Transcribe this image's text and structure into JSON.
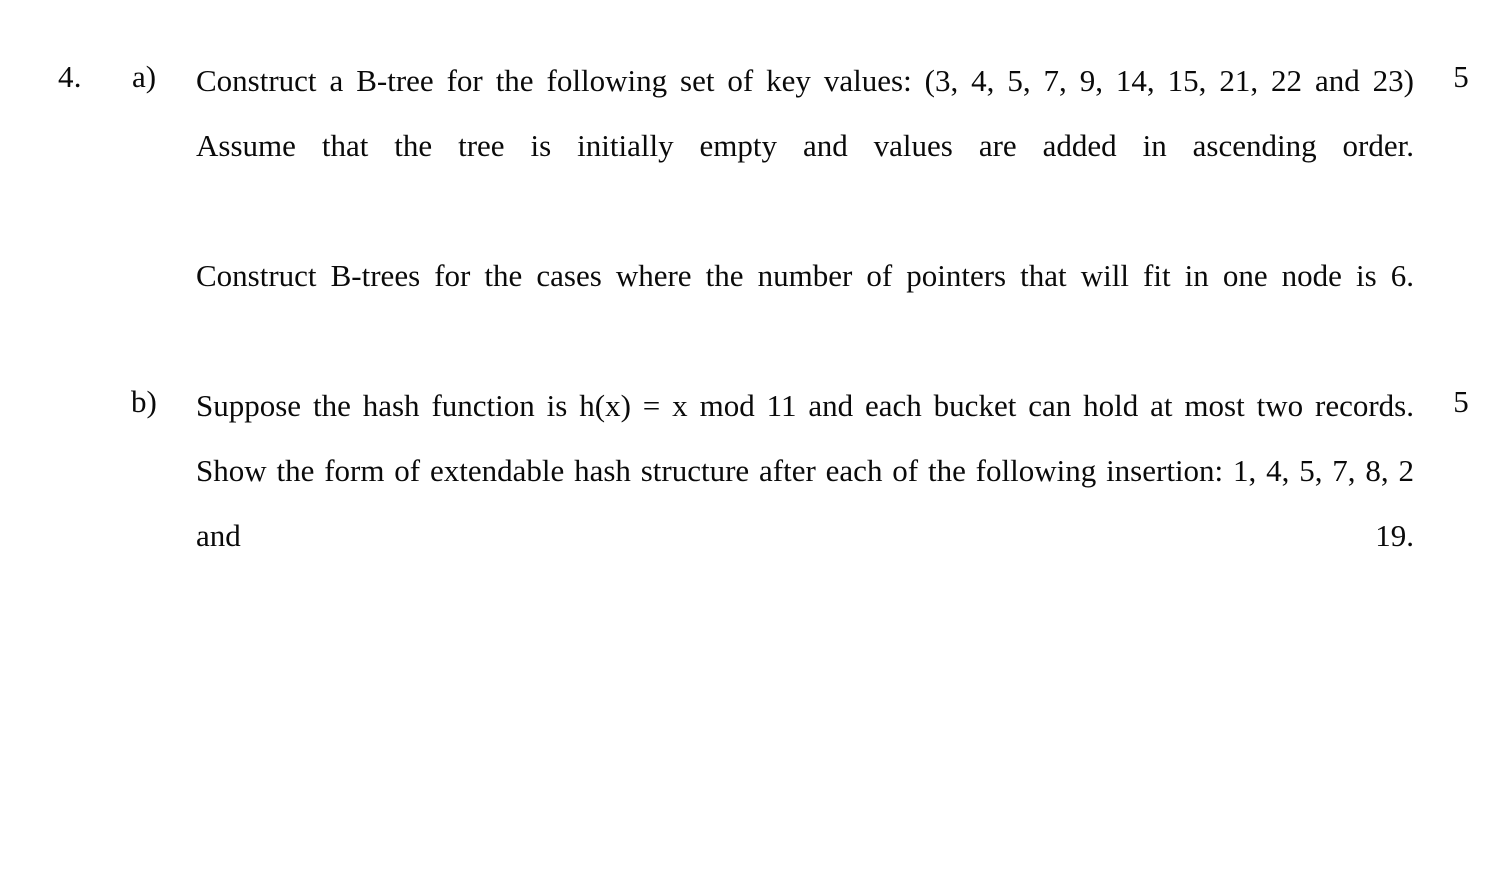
{
  "document": {
    "type": "exam-question-sheet",
    "background_color": "#ffffff",
    "text_color": "#0a0a0a"
  },
  "question": {
    "number": "4.",
    "parts": [
      {
        "label": "a)",
        "marks": "5",
        "paragraphs": [
          {
            "id": "a-p1",
            "lines": [
              "Construct a B-tree for the following set of key values:",
              "(3, 4, 5, 7, 9, 14, 15, 21, 22 and 23) Assume that the tree is initially empty and",
              "values are added in ascending order."
            ],
            "text": "Construct a B-tree for the following set of key values: (3, 4, 5, 7, 9, 14, 15, 21, 22 and 23) Assume that the tree is initially empty and values are added in ascending order."
          },
          {
            "id": "a-p2",
            "lines": [
              "Construct B-trees for the cases where the number of pointers that will fit in one",
              "node is 6."
            ],
            "text": "Construct B-trees for the cases where the number of pointers that will fit in one node is 6."
          }
        ]
      },
      {
        "label": "b)",
        "marks": "5",
        "paragraphs": [
          {
            "id": "b-p1",
            "lines": [
              "Suppose the hash function is h(x) = x mod 11 and each bucket can hold at",
              "most two records. Show the form of extendable hash structure after each of",
              "the following insertion: 1, 4, 5, 7, 8, 2 and 19."
            ],
            "text": "Suppose the hash function is h(x) = x mod 11 and each bucket can hold at most two records. Show the form of extendable hash structure after each of the following insertion: 1, 4, 5, 7, 8, 2 and 19."
          }
        ]
      }
    ]
  }
}
